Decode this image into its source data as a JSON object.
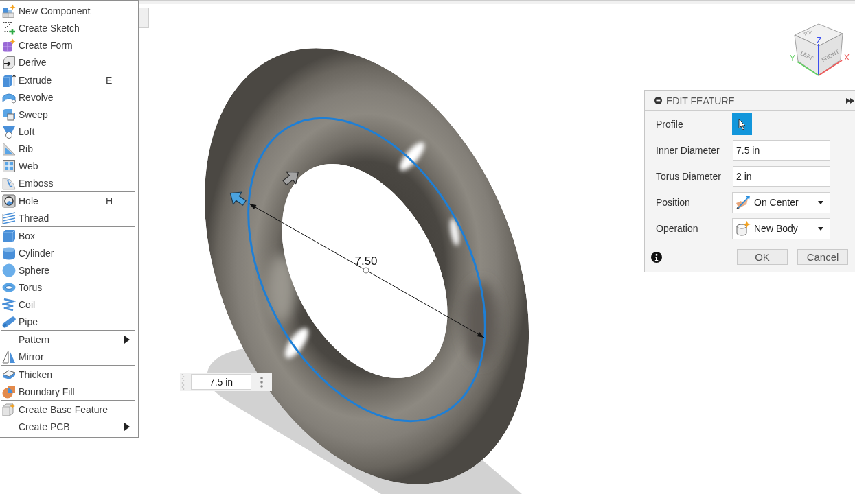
{
  "menu": {
    "groups": [
      {
        "items": [
          {
            "label": "New Component",
            "submenu": false
          },
          {
            "label": "Create Sketch",
            "submenu": false
          },
          {
            "label": "Create Form",
            "submenu": false
          },
          {
            "label": "Derive",
            "submenu": false
          }
        ]
      },
      {
        "items": [
          {
            "label": "Extrude",
            "shortcut": "E",
            "submenu": false
          },
          {
            "label": "Revolve",
            "submenu": false
          },
          {
            "label": "Sweep",
            "submenu": false
          },
          {
            "label": "Loft",
            "submenu": false
          },
          {
            "label": "Rib",
            "submenu": false
          },
          {
            "label": "Web",
            "submenu": false
          },
          {
            "label": "Emboss",
            "submenu": false
          }
        ]
      },
      {
        "items": [
          {
            "label": "Hole",
            "shortcut": "H",
            "submenu": false
          },
          {
            "label": "Thread",
            "submenu": false
          }
        ]
      },
      {
        "items": [
          {
            "label": "Box",
            "submenu": false
          },
          {
            "label": "Cylinder",
            "submenu": false
          },
          {
            "label": "Sphere",
            "submenu": false
          },
          {
            "label": "Torus",
            "submenu": false
          },
          {
            "label": "Coil",
            "submenu": false
          },
          {
            "label": "Pipe",
            "submenu": false
          }
        ]
      },
      {
        "items": [
          {
            "label": "Pattern",
            "submenu": true
          },
          {
            "label": "Mirror",
            "submenu": false
          }
        ]
      },
      {
        "items": [
          {
            "label": "Thicken",
            "submenu": false
          },
          {
            "label": "Boundary Fill",
            "submenu": false
          }
        ]
      },
      {
        "items": [
          {
            "label": "Create Base Feature",
            "submenu": false
          },
          {
            "label": "Create PCB",
            "submenu": true
          }
        ]
      }
    ]
  },
  "canvas": {
    "dimension": {
      "label": "7.50"
    },
    "view_cube": {
      "faces": [
        "TOP",
        "LEFT",
        "FRONT"
      ],
      "axes": [
        "Z",
        "Y",
        "X"
      ]
    }
  },
  "dimension_input": {
    "value": "7.5 in"
  },
  "edit_feature": {
    "title": "EDIT FEATURE",
    "fields": [
      {
        "kind": "select_button",
        "label": "Profile",
        "selected": true
      },
      {
        "kind": "input",
        "label": "Inner Diameter",
        "value": "7.5 in"
      },
      {
        "kind": "input",
        "label": "Torus Diameter",
        "value": "2 in"
      },
      {
        "kind": "dropdown",
        "label": "Position",
        "value": "On Center"
      },
      {
        "kind": "dropdown",
        "label": "Operation",
        "value": "New Body"
      }
    ],
    "buttons": [
      {
        "label": "OK"
      },
      {
        "label": "Cancel"
      }
    ]
  }
}
